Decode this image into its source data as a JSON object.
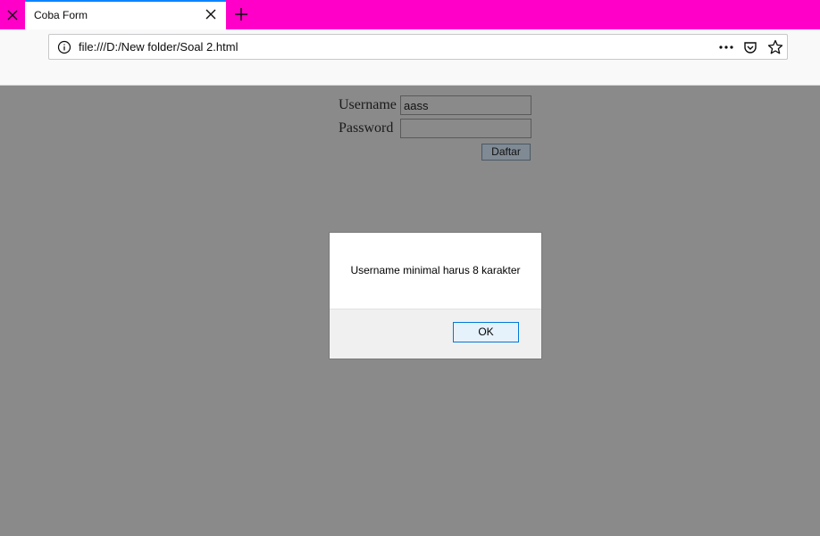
{
  "browser": {
    "tab_title": "Coba Form",
    "url": "file:///D:/New folder/Soal 2.html"
  },
  "form": {
    "username_label": "Username",
    "username_value": "aass",
    "password_label": "Password",
    "password_value": "",
    "submit_label": "Daftar"
  },
  "alert": {
    "message": "Username minimal harus 8 karakter",
    "ok_label": "OK"
  },
  "colors": {
    "tabbar": "#ff00c8",
    "page_overlay": "#8a8a8a",
    "ok_border": "#0078d7"
  }
}
